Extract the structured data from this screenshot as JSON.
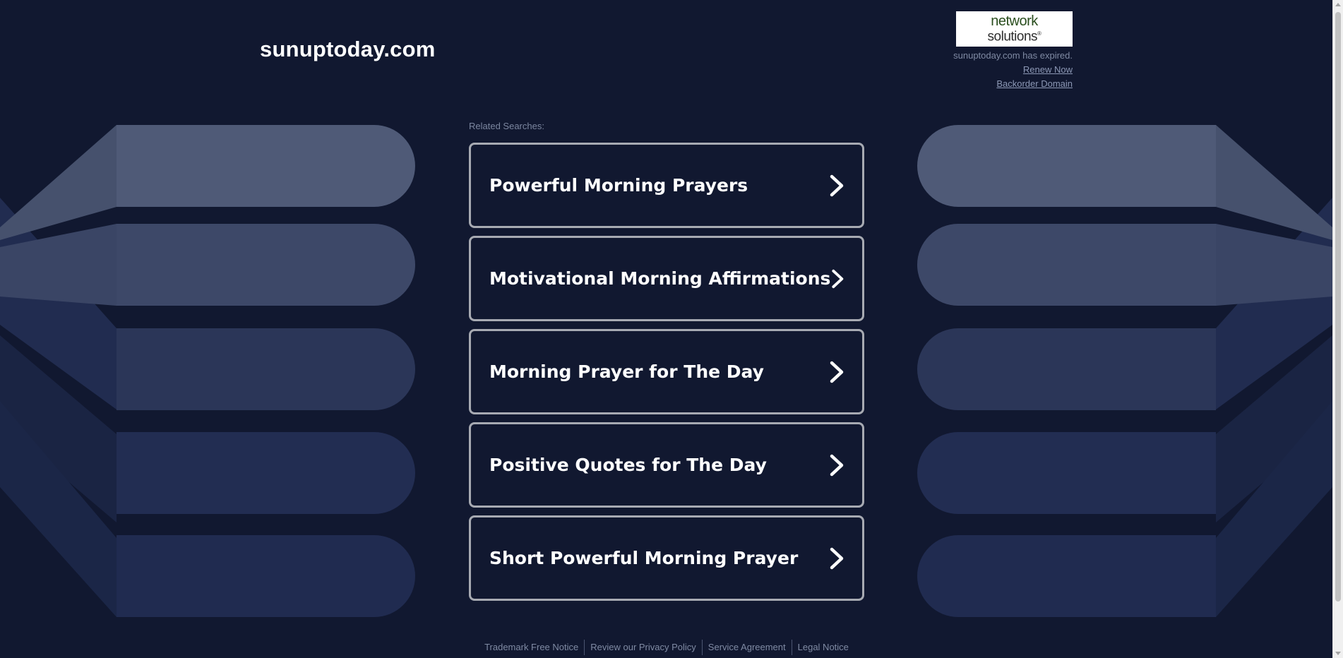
{
  "site": {
    "title": "sunuptoday.com"
  },
  "registrar": {
    "logo_line1": "network",
    "logo_line2": "solutions",
    "logo_mark": "®",
    "expired_text": "sunuptoday.com has expired.",
    "renew_label": "Renew Now",
    "backorder_label": "Backorder Domain"
  },
  "related": {
    "label": "Related Searches:",
    "items": [
      {
        "label": "Powerful Morning Prayers",
        "icon": "chevron-right-icon"
      },
      {
        "label": "Motivational Morning Affirmations",
        "icon": "chevron-right-icon"
      },
      {
        "label": "Morning Prayer for The Day",
        "icon": "chevron-right-icon"
      },
      {
        "label": "Positive Quotes for The Day",
        "icon": "chevron-right-icon"
      },
      {
        "label": "Short Powerful Morning Prayer",
        "icon": "chevron-right-icon"
      }
    ]
  },
  "footer": {
    "links": [
      "Trademark Free Notice",
      "Review our Privacy Policy",
      "Service Agreement",
      "Legal Notice"
    ]
  },
  "colors": {
    "background": "#111830",
    "card_border": "#a7aab2",
    "text": "#ffffff",
    "muted_text": "#7f8aa3",
    "logo_green": "#2a4e1e"
  }
}
